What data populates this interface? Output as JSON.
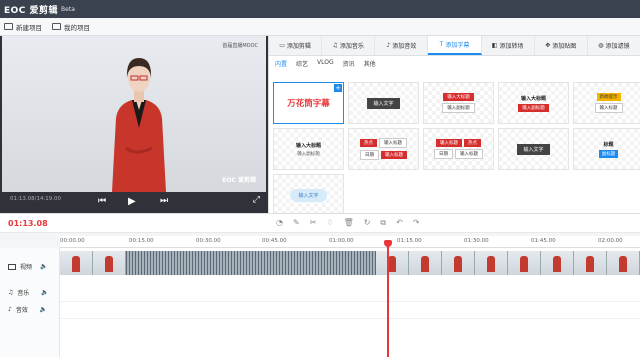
{
  "app": {
    "logo": "EOC 爱剪辑",
    "edition": "Beta"
  },
  "toolbar": {
    "new_project": "新建项目",
    "my_projects": "我的项目"
  },
  "preview": {
    "watermark_top": "首届直播MOOC",
    "watermark_bottom": "EOC 爱剪辑",
    "timecode": "01:13.08/14:19.00"
  },
  "tabs": [
    {
      "label": "添加剪辑",
      "icon": "clip-icon"
    },
    {
      "label": "添加音乐",
      "icon": "music-icon"
    },
    {
      "label": "添加音效",
      "icon": "sound-effect-icon"
    },
    {
      "label": "添加字幕",
      "icon": "text-icon",
      "active": true
    },
    {
      "label": "添加转场",
      "icon": "transition-icon"
    },
    {
      "label": "添加贴图",
      "icon": "sticker-icon"
    },
    {
      "label": "添加滤镜",
      "icon": "filter-icon"
    }
  ],
  "subtabs": [
    {
      "label": "内置",
      "active": true
    },
    {
      "label": "综艺"
    },
    {
      "label": "VLOG"
    },
    {
      "label": "资讯"
    },
    {
      "label": "其他"
    }
  ],
  "captions": {
    "c1": "万花筒字幕",
    "c2": "输入文字",
    "c3_main": "输入大标题",
    "c3_sub": "输入副标题",
    "c4_main": "输入大标题",
    "c4_sub": "输入副标题",
    "c5_top": "新闻提示",
    "c5_bottom": "输入标题",
    "c6_main": "输入大标题",
    "c6_sub": "输入副标题",
    "c7_a": "热点",
    "c7_b": "输入标题",
    "c7_c": "日期",
    "c7_d": "输入标题",
    "c8_a": "输入标题",
    "c8_b": "热点",
    "c8_c": "日期",
    "c8_d": "输入标题",
    "c9": "输入文字",
    "c10_top": "标题",
    "c10_bottom": "副标题",
    "c11": "输入文字"
  },
  "timeline": {
    "current_time": "01:13.08",
    "ticks": [
      "00:00.00",
      "00:15.00",
      "00:30.00",
      "00:45.00",
      "01:00.00",
      "01:15.00",
      "01:30.00",
      "01:45.00",
      "02:00.00"
    ],
    "tracks": {
      "video": "视频",
      "music": "音乐",
      "sfx": "音效"
    }
  },
  "colors": {
    "accent": "#1b8bf0",
    "danger": "#e8363a",
    "titlebar": "#3a4250"
  }
}
